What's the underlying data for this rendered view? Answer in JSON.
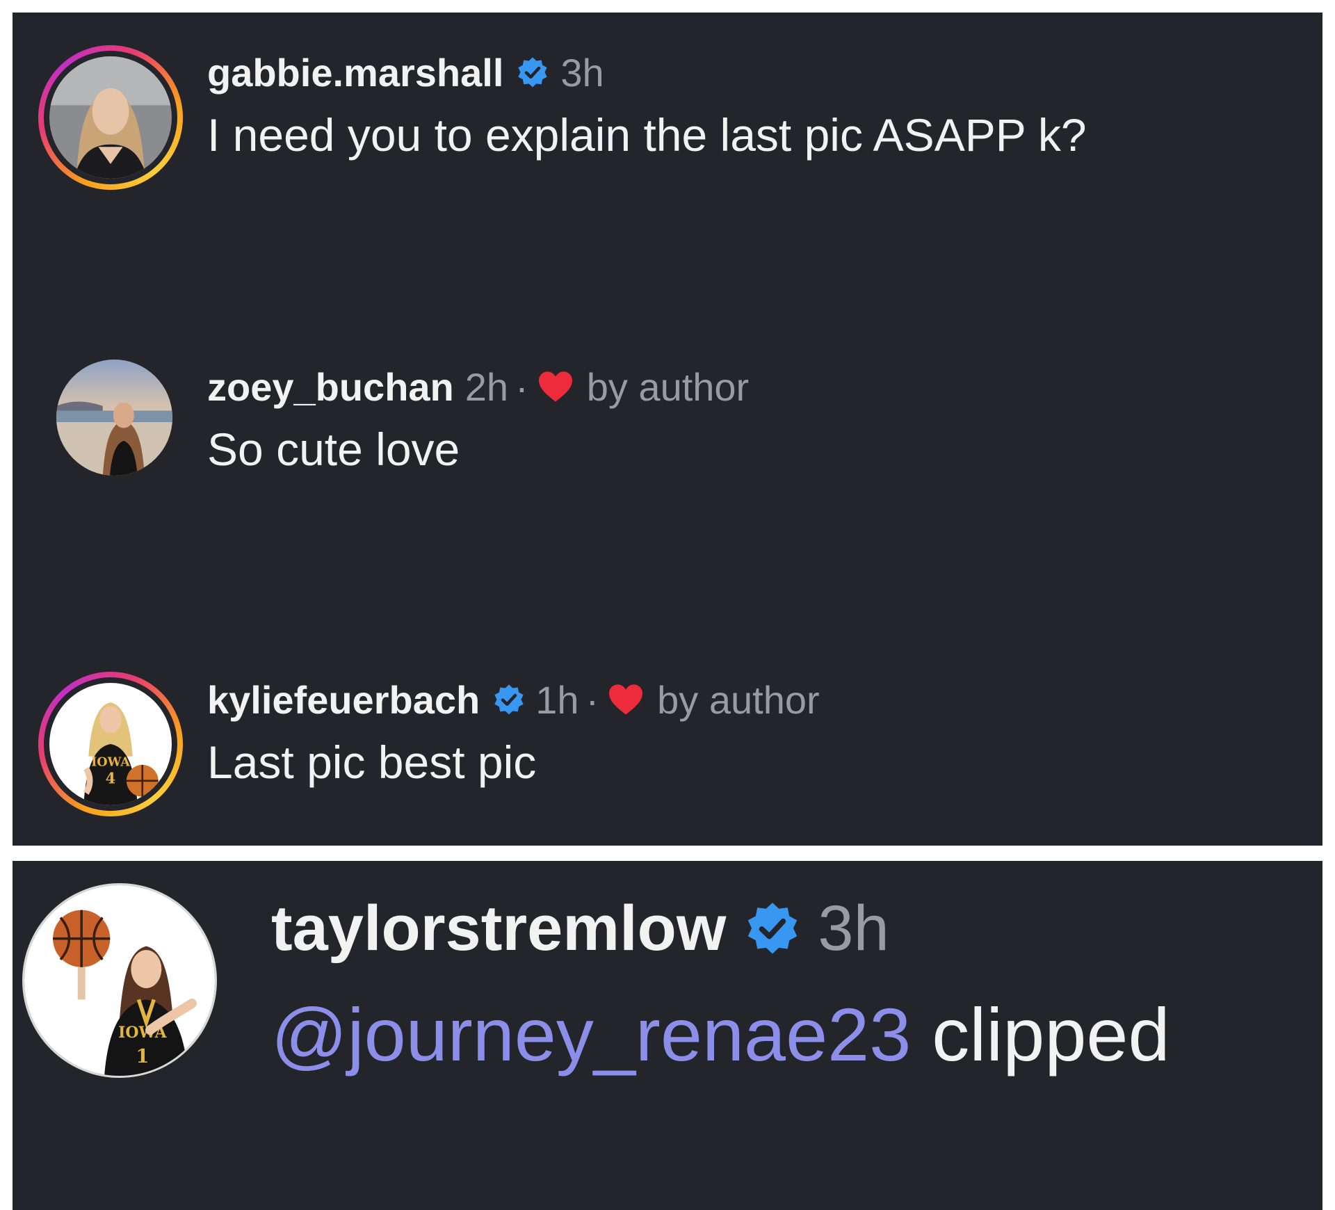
{
  "comments": [
    {
      "username": "gabbie.marshall",
      "verified": true,
      "time": "3h",
      "liked_by_author": false,
      "text": "I need you to explain the last pic ASAPP k?"
    },
    {
      "username": "zoey_buchan",
      "verified": false,
      "time": "2h",
      "separator": "·",
      "liked_by_author": true,
      "liked_label": "by author",
      "text": "So cute love"
    },
    {
      "username": "kyliefeuerbach",
      "verified": true,
      "time": "1h",
      "separator": "·",
      "liked_by_author": true,
      "liked_label": "by author",
      "text": "Last pic best pic"
    },
    {
      "username": "taylorstremlow",
      "verified": true,
      "time": "3h",
      "liked_by_author": false,
      "mention": "@journey_renae23",
      "text": "clipped"
    }
  ],
  "colors": {
    "background": "#24252b",
    "text": "#f2f2f2",
    "meta": "#9a9ba0",
    "verified": "#3897f0",
    "heart": "#ed2b3a",
    "mention": "#8b8fea"
  },
  "icons": {
    "verified": "verified-badge-icon",
    "heart": "heart-icon"
  }
}
